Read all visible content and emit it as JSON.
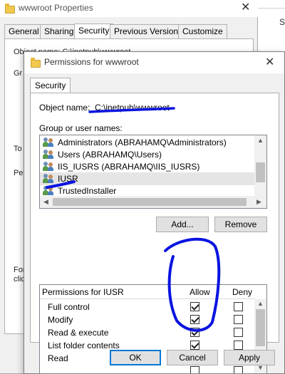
{
  "back_window": {
    "title": "wwwroot Properties",
    "tabs": [
      "General",
      "Sharing",
      "Security",
      "Previous Versions",
      "Customize"
    ],
    "active_tab": "Security",
    "object_name_fragment": "Object name:   C:\\inetpub\\wwwroot",
    "side_fragments": [
      "Gr",
      "To",
      "Pe",
      "For",
      "clic"
    ],
    "right_edge_fragment": "S"
  },
  "dialog": {
    "title": "Permissions for wwwroot",
    "tab": "Security",
    "object_name_label": "Object name:",
    "object_name_value": "C:\\inetpub\\wwwroot",
    "group_label": "Group or user names:",
    "users": [
      {
        "label": "Administrators (ABRAHAMQ\\Administrators)",
        "icon": "user-group-icon"
      },
      {
        "label": "Users (ABRAHAMQ\\Users)",
        "icon": "user-group-icon"
      },
      {
        "label": "IIS_IUSRS (ABRAHAMQ\\IIS_IUSRS)",
        "icon": "user-group-icon"
      },
      {
        "label": "IUSR",
        "icon": "user-group-icon",
        "selected": true
      },
      {
        "label": "TrustedInstaller",
        "icon": "user-group-icon"
      }
    ],
    "add_button": "Add...",
    "remove_button": "Remove",
    "permissions_header": "Permissions for IUSR",
    "allow_header": "Allow",
    "deny_header": "Deny",
    "permissions": [
      {
        "label": "Full control",
        "allow": true,
        "deny": false
      },
      {
        "label": "Modify",
        "allow": true,
        "deny": false
      },
      {
        "label": "Read & execute",
        "allow": true,
        "deny": false
      },
      {
        "label": "List folder contents",
        "allow": true,
        "deny": false
      },
      {
        "label": "Read",
        "allow": true,
        "deny": false
      }
    ],
    "ok_button": "OK",
    "cancel_button": "Cancel",
    "apply_button": "Apply"
  },
  "colors": {
    "annotation_pen": "#0a14e0",
    "window_bg": "#f0f0f0",
    "selection": "#e5e5e5"
  }
}
